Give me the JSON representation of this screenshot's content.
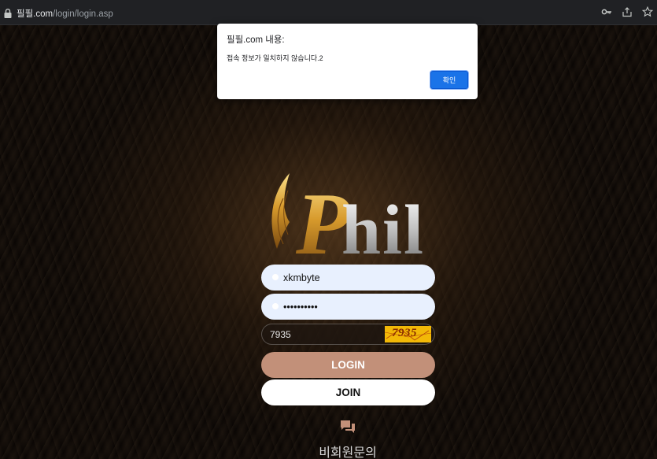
{
  "browser": {
    "url_host": "필필.com",
    "url_path": "/login/login.asp",
    "icons": [
      "lock-icon",
      "key-icon",
      "share-icon",
      "bookmark-star-icon"
    ]
  },
  "dialog": {
    "title": "필필.com 내용:",
    "message": "접속 정보가 일치하지 않습니다.2",
    "ok_label": "확인"
  },
  "logo": {
    "letter": "P",
    "rest": "hil"
  },
  "login_form": {
    "username_value": "xkmbyte",
    "password_value": "••••••••••",
    "captcha_input_value": "7935",
    "captcha_image_text": "7935",
    "login_label": "LOGIN",
    "join_label": "JOIN"
  },
  "inquiry": {
    "label": "비회원문의"
  },
  "colors": {
    "login_button": "#c29079",
    "join_button": "#ffffff",
    "dialog_button": "#1a73e8",
    "input_bg": "#e8f0fe",
    "captcha_bg": "#f2b807"
  }
}
